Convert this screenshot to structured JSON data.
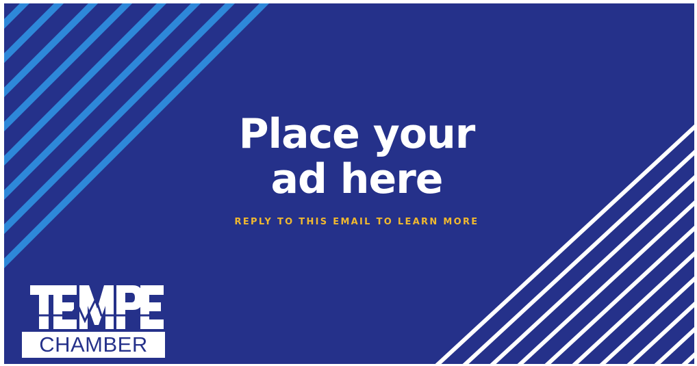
{
  "ad": {
    "headline_line1": "Place your",
    "headline_line2": "ad here",
    "subline": "REPLY TO THIS EMAIL TO LEARN MORE"
  },
  "logo": {
    "top_text": "TEMPE",
    "bottom_text": "CHAMBER"
  },
  "colors": {
    "background": "#25318a",
    "accent_yellow": "#f1b92f",
    "stripe_light_blue": "#2e88d9",
    "stripe_white": "#ffffff"
  },
  "decorations": {
    "left_stripes": "diagonal-light-blue-stripes",
    "right_stripes": "diagonal-white-stripes"
  }
}
